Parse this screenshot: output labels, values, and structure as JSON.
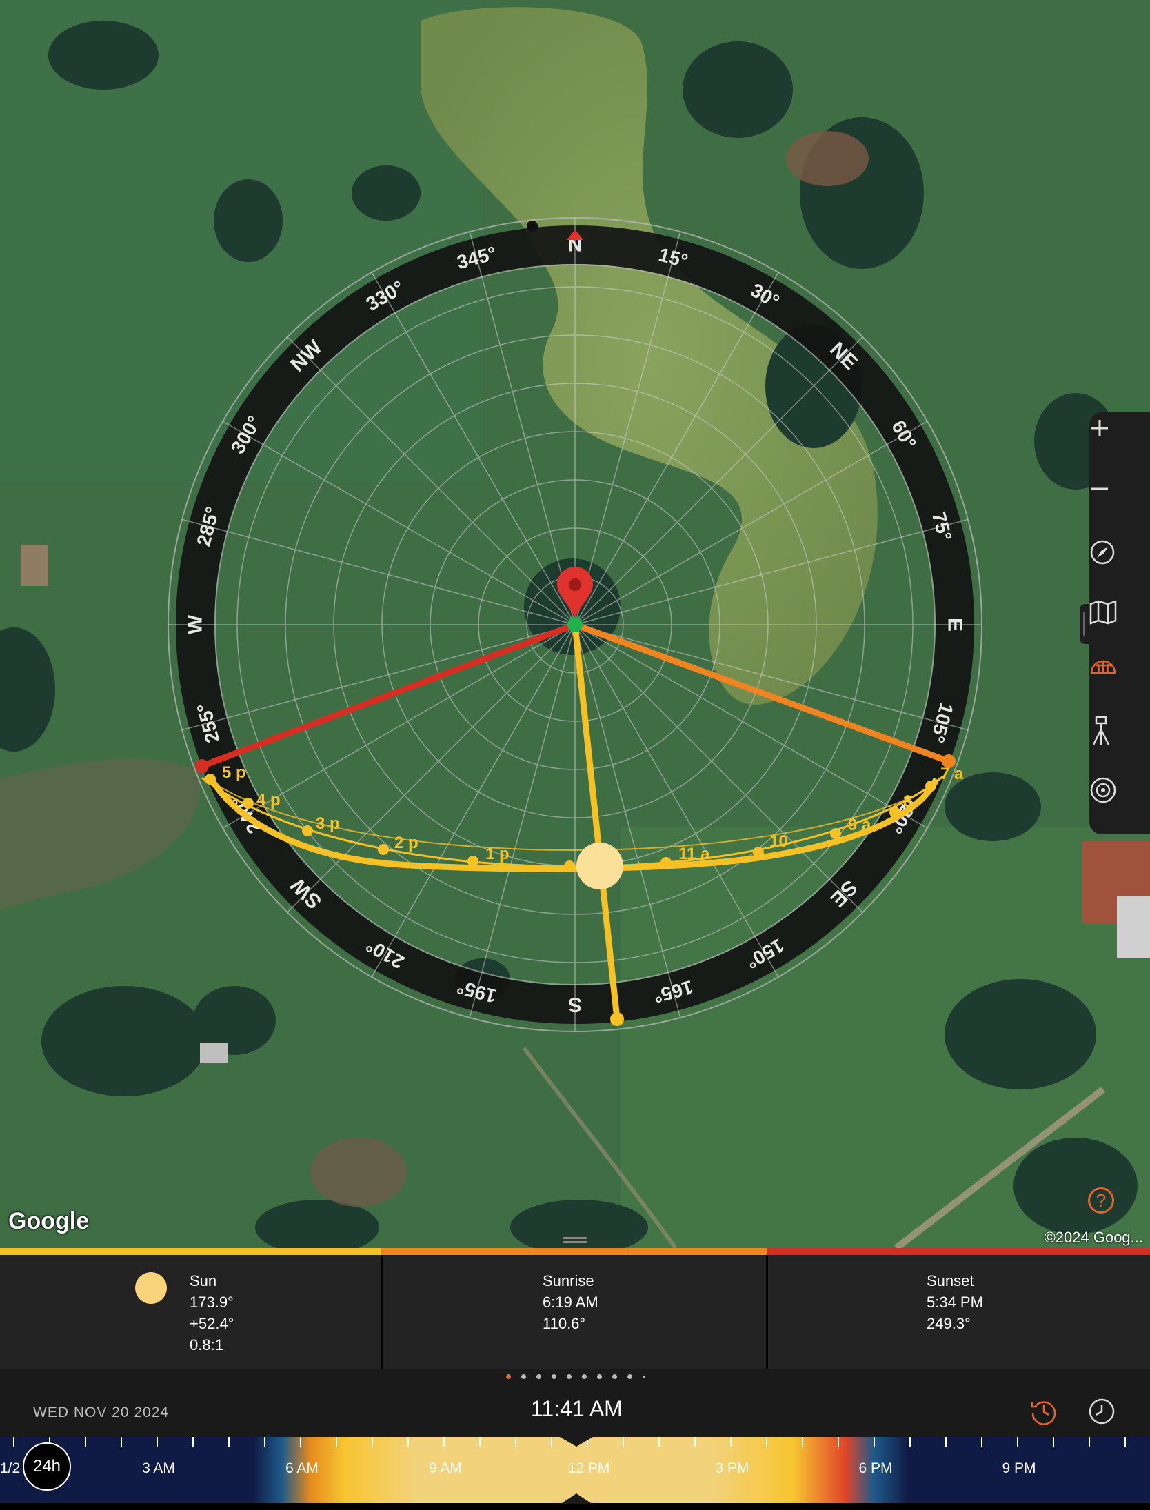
{
  "map": {
    "logo_text": "Google",
    "copyright": "©2024 Goog...",
    "help_icon": "question-icon",
    "compass": {
      "cardinals": {
        "N": "N",
        "NE": "NE",
        "E": "E",
        "SE": "SE",
        "S": "S",
        "SW": "SW",
        "W": "W",
        "NW": "NW"
      },
      "degree_labels": [
        "15°",
        "30°",
        "60°",
        "75°",
        "105°",
        "120°",
        "150°",
        "165°",
        "195°",
        "210°",
        "240°",
        "255°",
        "285°",
        "300°",
        "330°",
        "345°"
      ]
    },
    "sun_path_labels": [
      "5 p",
      "4 p",
      "3 p",
      "2 p",
      "1 p",
      "11 a",
      "10",
      "9 a",
      "8",
      "7 a"
    ],
    "colors": {
      "sun_path": "#f5c125",
      "sunrise_line": "#ef8420",
      "sunset_line": "#d42f22",
      "pin": "#e1332d",
      "center_dot": "#22b24c"
    }
  },
  "toolbar": {
    "zoom_in_icon": "plus-icon",
    "zoom_out_icon": "minus-icon",
    "compass_icon": "compass-icon",
    "map_icon": "map-icon",
    "planisphere_icon": "planisphere-icon",
    "tripod_icon": "tripod-icon",
    "target_icon": "target-icon",
    "active_tool": "planisphere-icon"
  },
  "info": {
    "sun": {
      "title": "Sun",
      "azimuth": "173.9°",
      "elevation": "+52.4°",
      "ratio": "0.8:1",
      "color": "#f8d37c"
    },
    "sunrise": {
      "title": "Sunrise",
      "time": "6:19 AM",
      "azimuth": "110.6°",
      "color": "#ef8420"
    },
    "sunset": {
      "title": "Sunset",
      "time": "5:34 PM",
      "azimuth": "249.3°",
      "color": "#d42f22"
    }
  },
  "pager": {
    "total": 10,
    "active_index": 0,
    "active_color": "#e8622a"
  },
  "datebar": {
    "date": "WED NOV 20 2024",
    "time": "11:41 AM",
    "reset_icon": "history-icon",
    "clock_icon": "clock-icon"
  },
  "timeline": {
    "mode_button": "24h",
    "partial_label": "1/2",
    "tick_labels": [
      "3 AM",
      "6 AM",
      "9 AM",
      "12 PM",
      "3 PM",
      "6 PM",
      "9 PM"
    ]
  }
}
